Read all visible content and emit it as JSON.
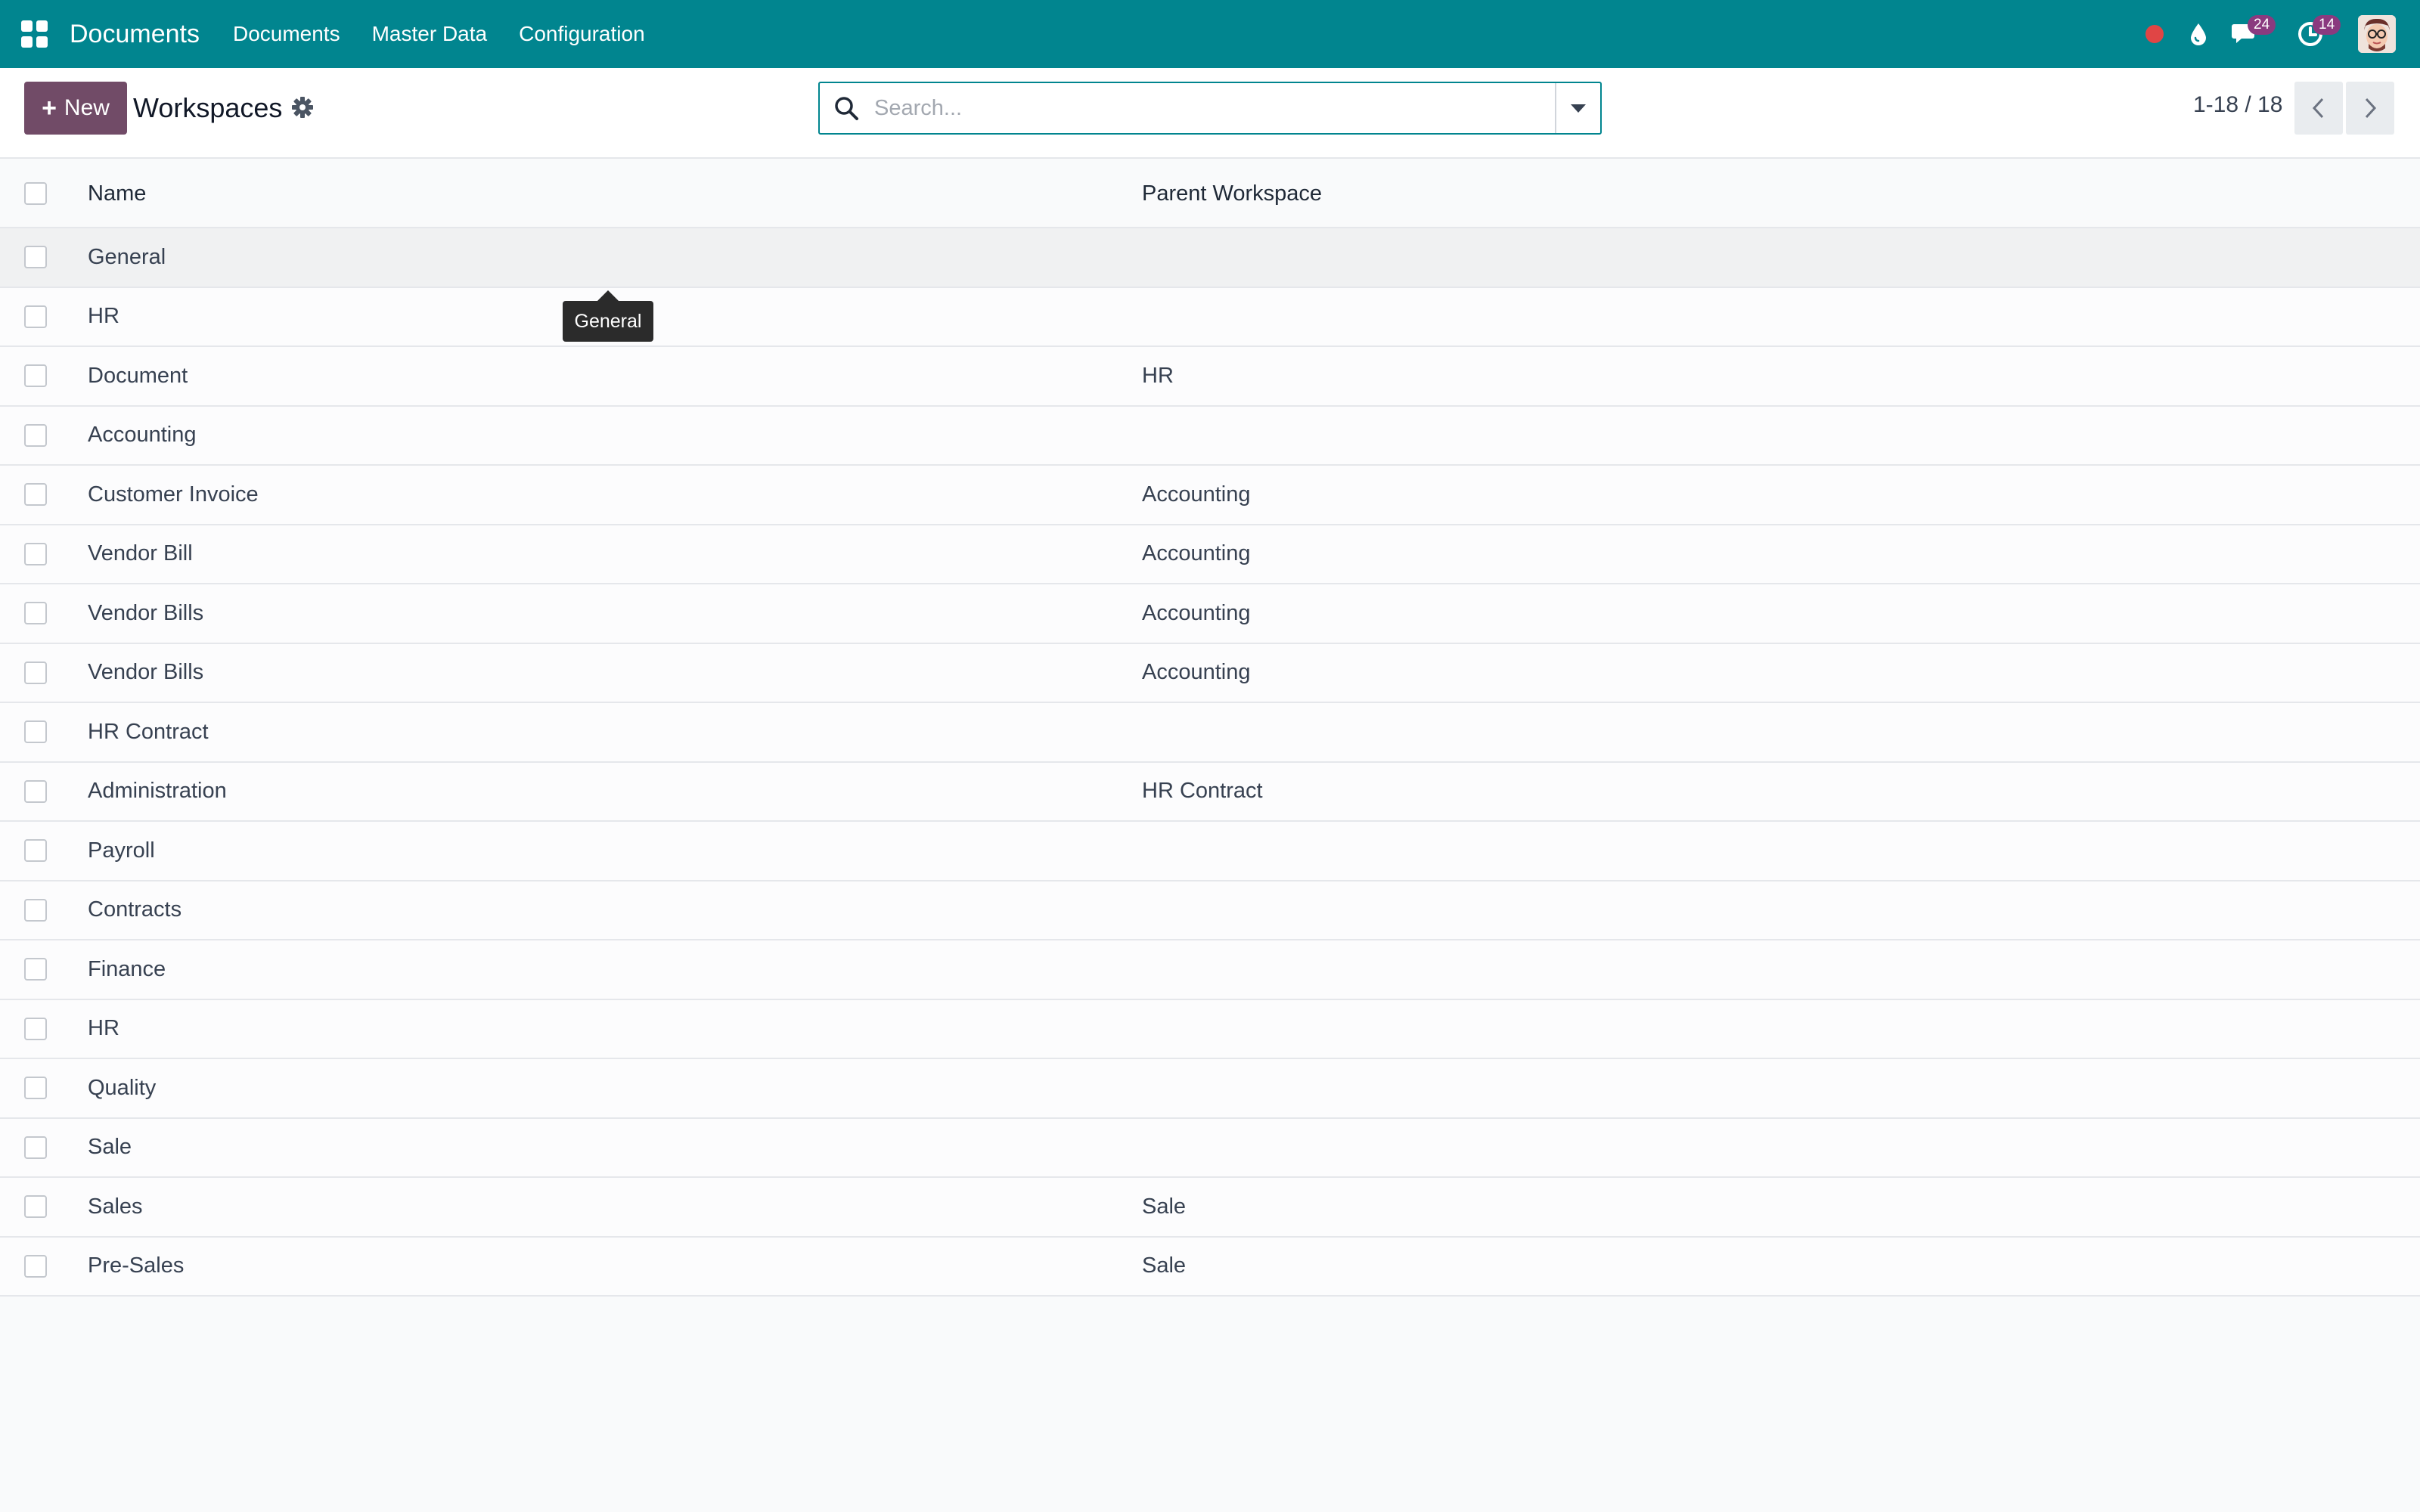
{
  "navbar": {
    "brand": "Documents",
    "menu": [
      "Documents",
      "Master Data",
      "Configuration"
    ],
    "messages_count": "24",
    "activities_count": "14",
    "color": "#01858f"
  },
  "control_panel": {
    "new_label": "New",
    "title": "Workspaces",
    "search_placeholder": "Search...",
    "pager": "1-18 / 18"
  },
  "list": {
    "columns": [
      "Name",
      "Parent Workspace"
    ],
    "rows": [
      {
        "name": "General",
        "parent": ""
      },
      {
        "name": "HR",
        "parent": ""
      },
      {
        "name": "Document",
        "parent": "HR"
      },
      {
        "name": "Accounting",
        "parent": ""
      },
      {
        "name": "Customer Invoice",
        "parent": "Accounting"
      },
      {
        "name": "Vendor Bill",
        "parent": "Accounting"
      },
      {
        "name": "Vendor Bills",
        "parent": "Accounting"
      },
      {
        "name": "Vendor Bills",
        "parent": "Accounting"
      },
      {
        "name": "HR Contract",
        "parent": ""
      },
      {
        "name": "Administration",
        "parent": "HR Contract"
      },
      {
        "name": "Payroll",
        "parent": ""
      },
      {
        "name": "Contracts",
        "parent": ""
      },
      {
        "name": "Finance",
        "parent": ""
      },
      {
        "name": "HR",
        "parent": ""
      },
      {
        "name": "Quality",
        "parent": ""
      },
      {
        "name": "Sale",
        "parent": ""
      },
      {
        "name": "Sales",
        "parent": "Sale"
      },
      {
        "name": "Pre-Sales",
        "parent": "Sale"
      }
    ]
  },
  "tooltip": {
    "text": "General"
  },
  "accent_color": "#714b67"
}
